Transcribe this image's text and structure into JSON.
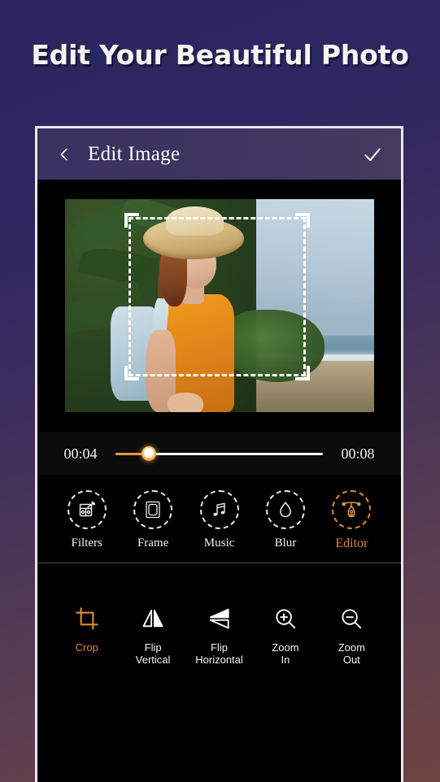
{
  "promo": {
    "title": "Edit Your Beautiful Photo"
  },
  "appbar": {
    "back_icon": "chevron-left-icon",
    "title": "Edit Image",
    "confirm_icon": "check-icon"
  },
  "photo": {
    "description": "Woman in orange shirt wearing a straw hat with a light blue backpack standing by palm trees at the beach",
    "crop_overlay": "dashed-crop-rectangle"
  },
  "timeline": {
    "start_time": "00:04",
    "end_time": "00:08",
    "progress_percent": 16,
    "fill_color": "#e89a3c",
    "track_color": "#ffffff"
  },
  "tools": {
    "items": [
      {
        "label": "Filters",
        "icon": "filters-icon",
        "selected": false
      },
      {
        "label": "Frame",
        "icon": "frame-icon",
        "selected": false
      },
      {
        "label": "Music",
        "icon": "music-note-icon",
        "selected": false
      },
      {
        "label": "Blur",
        "icon": "water-drop-icon",
        "selected": false
      },
      {
        "label": "Editor",
        "icon": "pen-tool-icon",
        "selected": true
      }
    ],
    "selected_color": "#d98936",
    "default_color": "#f0f0f0"
  },
  "editor_actions": {
    "items": [
      {
        "label": "Crop",
        "icon": "crop-icon",
        "selected": true
      },
      {
        "label": "Flip\nVertical",
        "icon": "flip-vertical-icon",
        "selected": false
      },
      {
        "label": "Flip\nHorizontal",
        "icon": "flip-horizontal-icon",
        "selected": false
      },
      {
        "label": "Zoom\nIn",
        "icon": "zoom-in-icon",
        "selected": false
      },
      {
        "label": "Zoom\nOut",
        "icon": "zoom-out-icon",
        "selected": false
      }
    ]
  },
  "theme": {
    "background_top": "#2a2560",
    "background_bottom_left": "#55395a",
    "background_bottom_right": "#6e4442",
    "appbar_background": "#3d3460",
    "screen_background": "#000000",
    "accent": "#d98936"
  }
}
